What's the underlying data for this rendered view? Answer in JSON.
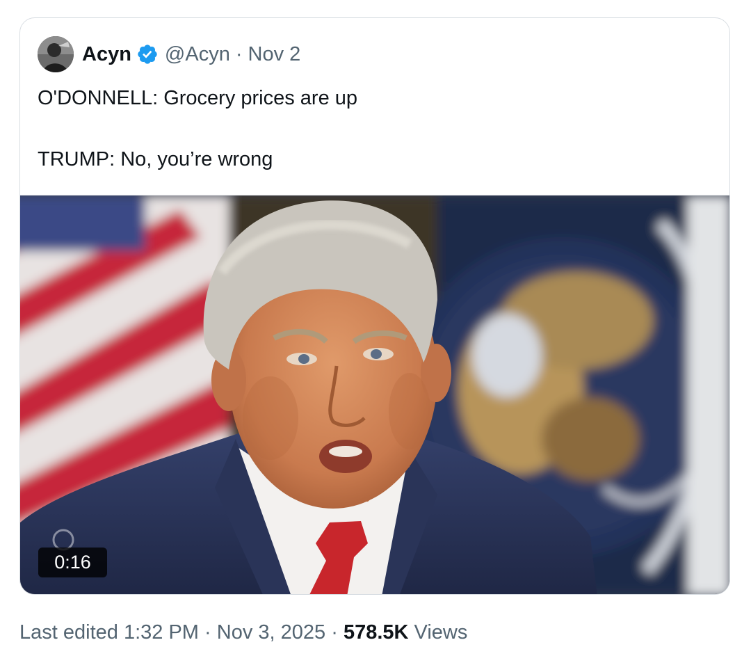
{
  "quoted_tweet": {
    "author_name": "Acyn",
    "author_handle": "@Acyn",
    "separator": "·",
    "date": "Nov 2",
    "text_line1": "O'DONNELL: Grocery prices are up",
    "text_line2": "TRUMP: No, you’re wrong",
    "video_duration": "0:16"
  },
  "footer": {
    "edited_text": "Last edited 1:32 PM",
    "separator": "·",
    "date": "Nov 3, 2025",
    "views_count": "578.5K",
    "views_label": "Views"
  },
  "colors": {
    "verified_badge": "#1d9bf0",
    "secondary_text": "#536471",
    "primary_text": "#0f1419"
  }
}
